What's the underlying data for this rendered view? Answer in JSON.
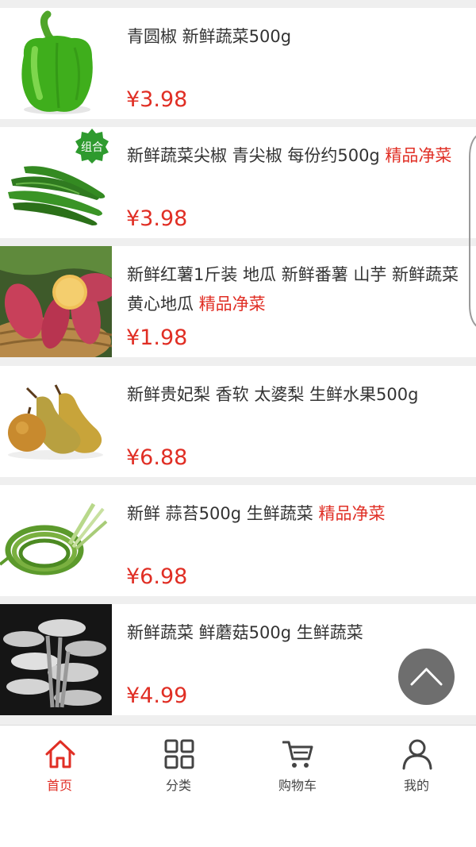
{
  "products": [
    {
      "title": "青圆椒 新鲜蔬菜500g",
      "tag": "",
      "price": "¥3.98",
      "image": "green-bell-pepper"
    },
    {
      "title": "新鲜蔬菜尖椒 青尖椒 每份约500g ",
      "tag": "精品净菜",
      "price": "¥3.98",
      "image": "green-chili-peppers",
      "badge": "组合"
    },
    {
      "title": "新鲜红薯1斤装 地瓜 新鲜番薯 山芋 新鲜蔬菜 黄心地瓜 ",
      "tag": "精品净菜",
      "price": "¥1.98",
      "image": "sweet-potatoes"
    },
    {
      "title": "新鲜贵妃梨 香软 太婆梨 生鲜水果500g",
      "tag": "",
      "price": "¥6.88",
      "image": "pears"
    },
    {
      "title": "新鲜 蒜苔500g 生鲜蔬菜 ",
      "tag": "精品净菜",
      "price": "¥6.98",
      "image": "garlic-scapes"
    },
    {
      "title": "新鲜蔬菜 鲜蘑菇500g 生鲜蔬菜",
      "tag": "",
      "price": "¥4.99",
      "image": "oyster-mushrooms"
    }
  ],
  "scroll_top_icon": "chevron-up-icon",
  "tabbar": {
    "tabs": [
      {
        "label": "首页",
        "icon": "home-icon",
        "active": true
      },
      {
        "label": "分类",
        "icon": "grid-icon",
        "active": false
      },
      {
        "label": "购物车",
        "icon": "cart-icon",
        "active": false
      },
      {
        "label": "我的",
        "icon": "user-icon",
        "active": false
      }
    ]
  },
  "colors": {
    "accent": "#e02e24",
    "text": "#333333",
    "divider": "#efefef"
  }
}
